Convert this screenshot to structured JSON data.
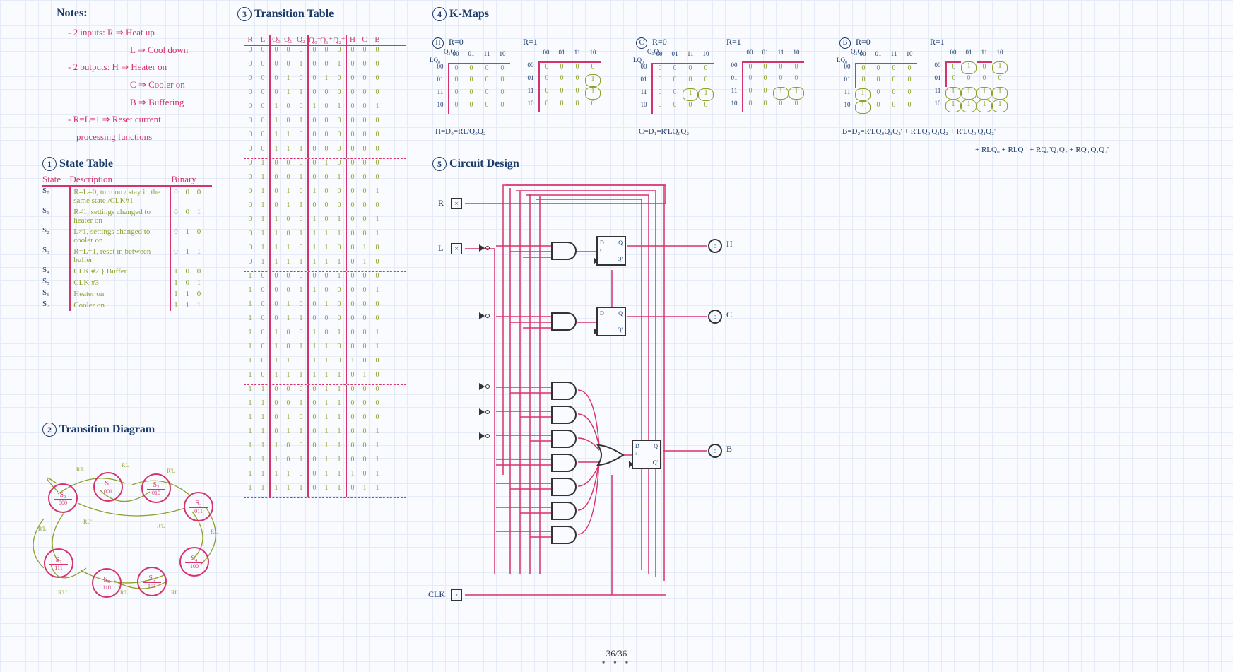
{
  "notes": {
    "title": "Notes:",
    "lines": [
      "- 2 inputs: R ⇒ Heat up",
      "L ⇒ Cool down",
      "- 2 outputs: H ⇒ Heater on",
      "C ⇒ Cooler on",
      "B ⇒ Buffering",
      "- R=L=1 ⇒ Reset current",
      "processing functions"
    ]
  },
  "section1": {
    "num": "1",
    "title": "State Table"
  },
  "state_table": {
    "headers": [
      "State",
      "Description",
      "Binary"
    ],
    "rows": [
      {
        "s": "S₀",
        "desc": "R=L=0, turn on / stay in the same state /CLK#1",
        "bin": "0 0 0"
      },
      {
        "s": "S₁",
        "desc": "R≠1, settings changed to heater on",
        "bin": "0 0 1"
      },
      {
        "s": "S₂",
        "desc": "L≠1, settings changed to cooler on",
        "bin": "0 1 0"
      },
      {
        "s": "S₃",
        "desc": "R=L=1, reset in between buffer",
        "bin": "0 1 1"
      },
      {
        "s": "S₄",
        "desc": "CLK #2 } Buffer",
        "bin": "1 0 0"
      },
      {
        "s": "S₅",
        "desc": "CLK #3",
        "bin": "1 0 1"
      },
      {
        "s": "S₆",
        "desc": "Heater on",
        "bin": "1 1 0"
      },
      {
        "s": "S₇",
        "desc": "Cooler on",
        "bin": "1 1 1"
      }
    ]
  },
  "section2": {
    "num": "2",
    "title": "Transition Diagram"
  },
  "sd_nodes": [
    {
      "name": "S₀",
      "bin": "000"
    },
    {
      "name": "S₁",
      "bin": "001"
    },
    {
      "name": "S₂",
      "bin": "010"
    },
    {
      "name": "S₃",
      "bin": "011"
    },
    {
      "name": "S₄",
      "bin": "100"
    },
    {
      "name": "S₅",
      "bin": "101"
    },
    {
      "name": "S₆",
      "bin": "110"
    },
    {
      "name": "S₇",
      "bin": "111"
    }
  ],
  "section3": {
    "num": "3",
    "title": "Transition Table"
  },
  "tt_headers": [
    "R",
    "L",
    "Q₀",
    "Q₁",
    "Q₂",
    "Q₀⁺",
    "Q₁⁺",
    "Q₂⁺",
    "H",
    "C",
    "B"
  ],
  "tt_rows": [
    [
      "0",
      "0",
      "0",
      "0",
      "0",
      "0",
      "0",
      "0",
      "0",
      "0",
      "0"
    ],
    [
      "0",
      "0",
      "0",
      "0",
      "1",
      "0",
      "0",
      "1",
      "0",
      "0",
      "0"
    ],
    [
      "0",
      "0",
      "0",
      "1",
      "0",
      "0",
      "1",
      "0",
      "0",
      "0",
      "0"
    ],
    [
      "0",
      "0",
      "0",
      "1",
      "1",
      "0",
      "0",
      "0",
      "0",
      "0",
      "0"
    ],
    [
      "0",
      "0",
      "1",
      "0",
      "0",
      "1",
      "0",
      "1",
      "0",
      "0",
      "1"
    ],
    [
      "0",
      "0",
      "1",
      "0",
      "1",
      "0",
      "0",
      "0",
      "0",
      "0",
      "0"
    ],
    [
      "0",
      "0",
      "1",
      "1",
      "0",
      "0",
      "0",
      "0",
      "0",
      "0",
      "0"
    ],
    [
      "0",
      "0",
      "1",
      "1",
      "1",
      "0",
      "0",
      "0",
      "0",
      "0",
      "0"
    ],
    [
      "0",
      "1",
      "0",
      "0",
      "0",
      "0",
      "1",
      "0",
      "0",
      "0",
      "0"
    ],
    [
      "0",
      "1",
      "0",
      "0",
      "1",
      "0",
      "0",
      "1",
      "0",
      "0",
      "0"
    ],
    [
      "0",
      "1",
      "0",
      "1",
      "0",
      "1",
      "0",
      "0",
      "0",
      "0",
      "1"
    ],
    [
      "0",
      "1",
      "0",
      "1",
      "1",
      "0",
      "0",
      "0",
      "0",
      "0",
      "0"
    ],
    [
      "0",
      "1",
      "1",
      "0",
      "0",
      "1",
      "0",
      "1",
      "0",
      "0",
      "1"
    ],
    [
      "0",
      "1",
      "1",
      "0",
      "1",
      "1",
      "1",
      "1",
      "0",
      "0",
      "1"
    ],
    [
      "0",
      "1",
      "1",
      "1",
      "0",
      "1",
      "1",
      "0",
      "0",
      "1",
      "0"
    ],
    [
      "0",
      "1",
      "1",
      "1",
      "1",
      "1",
      "1",
      "1",
      "0",
      "1",
      "0"
    ],
    [
      "1",
      "0",
      "0",
      "0",
      "0",
      "0",
      "0",
      "1",
      "0",
      "0",
      "0"
    ],
    [
      "1",
      "0",
      "0",
      "0",
      "1",
      "1",
      "0",
      "0",
      "0",
      "0",
      "1"
    ],
    [
      "1",
      "0",
      "0",
      "1",
      "0",
      "0",
      "1",
      "0",
      "0",
      "0",
      "0"
    ],
    [
      "1",
      "0",
      "0",
      "1",
      "1",
      "0",
      "0",
      "0",
      "0",
      "0",
      "0"
    ],
    [
      "1",
      "0",
      "1",
      "0",
      "0",
      "1",
      "0",
      "1",
      "0",
      "0",
      "1"
    ],
    [
      "1",
      "0",
      "1",
      "0",
      "1",
      "1",
      "1",
      "0",
      "0",
      "0",
      "1"
    ],
    [
      "1",
      "0",
      "1",
      "1",
      "0",
      "1",
      "1",
      "0",
      "1",
      "0",
      "0"
    ],
    [
      "1",
      "0",
      "1",
      "1",
      "1",
      "1",
      "1",
      "1",
      "0",
      "1",
      "0"
    ],
    [
      "1",
      "1",
      "0",
      "0",
      "0",
      "0",
      "1",
      "1",
      "0",
      "0",
      "0"
    ],
    [
      "1",
      "1",
      "0",
      "0",
      "1",
      "0",
      "1",
      "1",
      "0",
      "0",
      "0"
    ],
    [
      "1",
      "1",
      "0",
      "1",
      "0",
      "0",
      "1",
      "1",
      "0",
      "0",
      "0"
    ],
    [
      "1",
      "1",
      "0",
      "1",
      "1",
      "0",
      "1",
      "1",
      "0",
      "0",
      "1"
    ],
    [
      "1",
      "1",
      "1",
      "0",
      "0",
      "0",
      "1",
      "1",
      "0",
      "0",
      "1"
    ],
    [
      "1",
      "1",
      "1",
      "0",
      "1",
      "0",
      "1",
      "1",
      "0",
      "0",
      "1"
    ],
    [
      "1",
      "1",
      "1",
      "1",
      "0",
      "0",
      "1",
      "1",
      "1",
      "0",
      "1"
    ],
    [
      "1",
      "1",
      "1",
      "1",
      "1",
      "0",
      "1",
      "1",
      "0",
      "1",
      "1"
    ]
  ],
  "section4": {
    "num": "4",
    "title": "K-Maps"
  },
  "kmap_axis": {
    "cols": "Q₁Q₂",
    "rows": "LQ₀",
    "col_labels": [
      "00",
      "01",
      "11",
      "10"
    ],
    "row_labels": [
      "00",
      "01",
      "11",
      "10"
    ]
  },
  "kmaps": {
    "H": {
      "letter": "H",
      "r0": {
        "title": "R=0",
        "cells": [
          [
            "0",
            "0",
            "0",
            "0"
          ],
          [
            "0",
            "0",
            "0",
            "0"
          ],
          [
            "0",
            "0",
            "0",
            "0"
          ],
          [
            "0",
            "0",
            "0",
            "0"
          ]
        ]
      },
      "r1": {
        "title": "R=1",
        "cells": [
          [
            "0",
            "0",
            "0",
            "0"
          ],
          [
            "0",
            "0",
            "0",
            "1"
          ],
          [
            "0",
            "0",
            "0",
            "1"
          ],
          [
            "0",
            "0",
            "0",
            "0"
          ]
        ]
      },
      "eq": "H=D₀=RL'Q₀Q₂"
    },
    "C": {
      "letter": "C",
      "r0": {
        "title": "R=0",
        "cells": [
          [
            "0",
            "0",
            "0",
            "0"
          ],
          [
            "0",
            "0",
            "0",
            "0"
          ],
          [
            "0",
            "0",
            "1",
            "1"
          ],
          [
            "0",
            "0",
            "0",
            "0"
          ]
        ]
      },
      "r1": {
        "title": "R=1",
        "cells": [
          [
            "0",
            "0",
            "0",
            "0"
          ],
          [
            "0",
            "0",
            "0",
            "0"
          ],
          [
            "0",
            "0",
            "1",
            "1"
          ],
          [
            "0",
            "0",
            "0",
            "0"
          ]
        ]
      },
      "eq": "C=D₁=R'LQ₀Q₂"
    },
    "B": {
      "letter": "B",
      "r0": {
        "title": "R=0",
        "cells": [
          [
            "0",
            "0",
            "0",
            "0"
          ],
          [
            "0",
            "0",
            "0",
            "0"
          ],
          [
            "1",
            "0",
            "0",
            "0"
          ],
          [
            "1",
            "0",
            "0",
            "0"
          ]
        ]
      },
      "r1": {
        "title": "R=1",
        "cells": [
          [
            "0",
            "1",
            "0",
            "1"
          ],
          [
            "0",
            "0",
            "0",
            "0"
          ],
          [
            "1",
            "1",
            "1",
            "1"
          ],
          [
            "1",
            "1",
            "1",
            "1"
          ]
        ]
      },
      "eq": "B=D₂=R'LQ₀Q₁Q₂' + R'LQ₀'Q₁Q₂ + R'LQ₀'Q₁Q₂'",
      "eq2": "+ RLQ₀ + RLQ₁' + RQ₀'Q₁Q₂ + RQ₀'Q₁Q₂'"
    }
  },
  "section5": {
    "num": "5",
    "title": "Circuit Design"
  },
  "circuit": {
    "inputs": [
      "R",
      "L",
      "CLK"
    ],
    "outputs": [
      "H",
      "C",
      "B"
    ],
    "ff_labels": {
      "d": "D",
      "q": "Q",
      "qb": "Q'",
      "clk": ">"
    }
  },
  "page": "36/36"
}
